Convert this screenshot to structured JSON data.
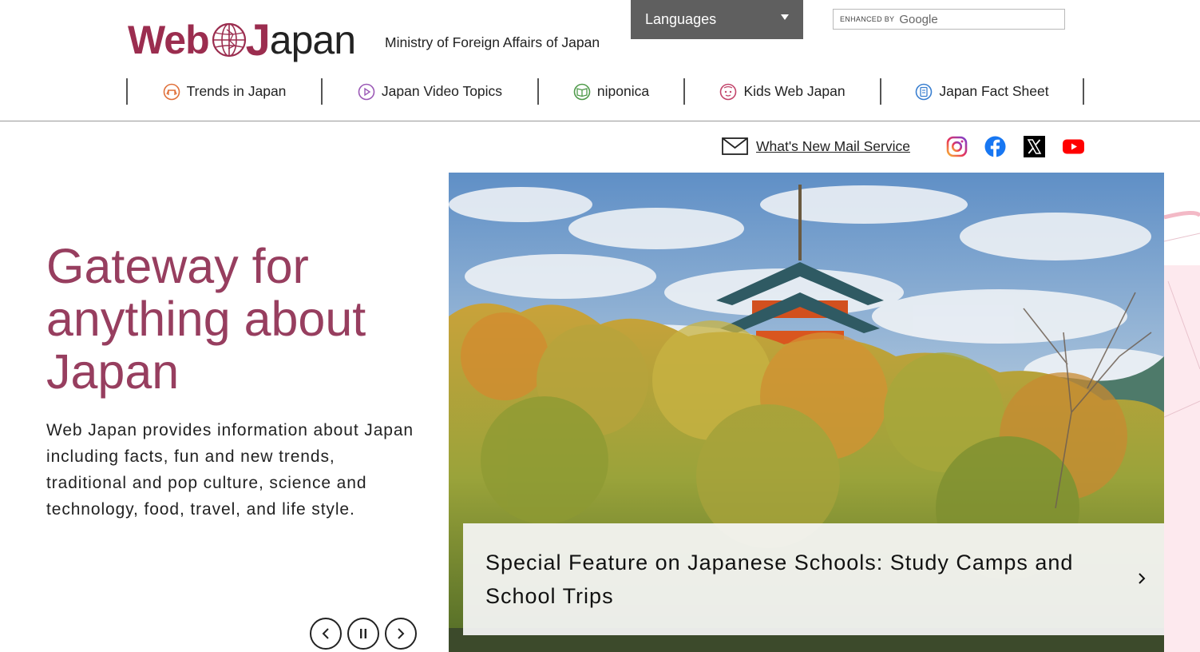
{
  "header": {
    "logo": {
      "web": "Web",
      "j": "J",
      "apan": "apan"
    },
    "ministry": "Ministry of Foreign Affairs of Japan",
    "languages_label": "Languages",
    "search": {
      "enhanced_by": "ENHANCED BY",
      "brand": "Google",
      "placeholder": ""
    }
  },
  "nav": [
    {
      "label": "Trends in Japan",
      "icon": "trends-icon",
      "color": "#e0703a"
    },
    {
      "label": "Japan Video Topics",
      "icon": "video-play-icon",
      "color": "#9b59b6"
    },
    {
      "label": "niponica",
      "icon": "book-icon",
      "color": "#4f9a4a"
    },
    {
      "label": "Kids Web Japan",
      "icon": "kids-face-icon",
      "color": "#c2456b"
    },
    {
      "label": "Japan Fact Sheet",
      "icon": "fact-sheet-icon",
      "color": "#3a7fd0"
    }
  ],
  "mail": {
    "label": "What's New Mail Service",
    "icon": "mail-icon"
  },
  "social": [
    {
      "name": "instagram-icon"
    },
    {
      "name": "facebook-icon"
    },
    {
      "name": "x-icon"
    },
    {
      "name": "youtube-icon"
    }
  ],
  "hero": {
    "title": "Gateway for anything about Japan",
    "description": "Web Japan provides information about Japan including facts, fun and new trends, traditional and pop culture, science and technology, food, travel, and life style."
  },
  "carousel": {
    "caption": "Special Feature on Japanese Schools: Study Camps and School Trips",
    "prev_icon": "chevron-left-icon",
    "pause_icon": "pause-icon",
    "next_icon": "chevron-right-icon"
  },
  "colors": {
    "brand": "#9b2d4f",
    "hero_title": "#973e5f",
    "languages_bg": "#5f5f5f"
  }
}
